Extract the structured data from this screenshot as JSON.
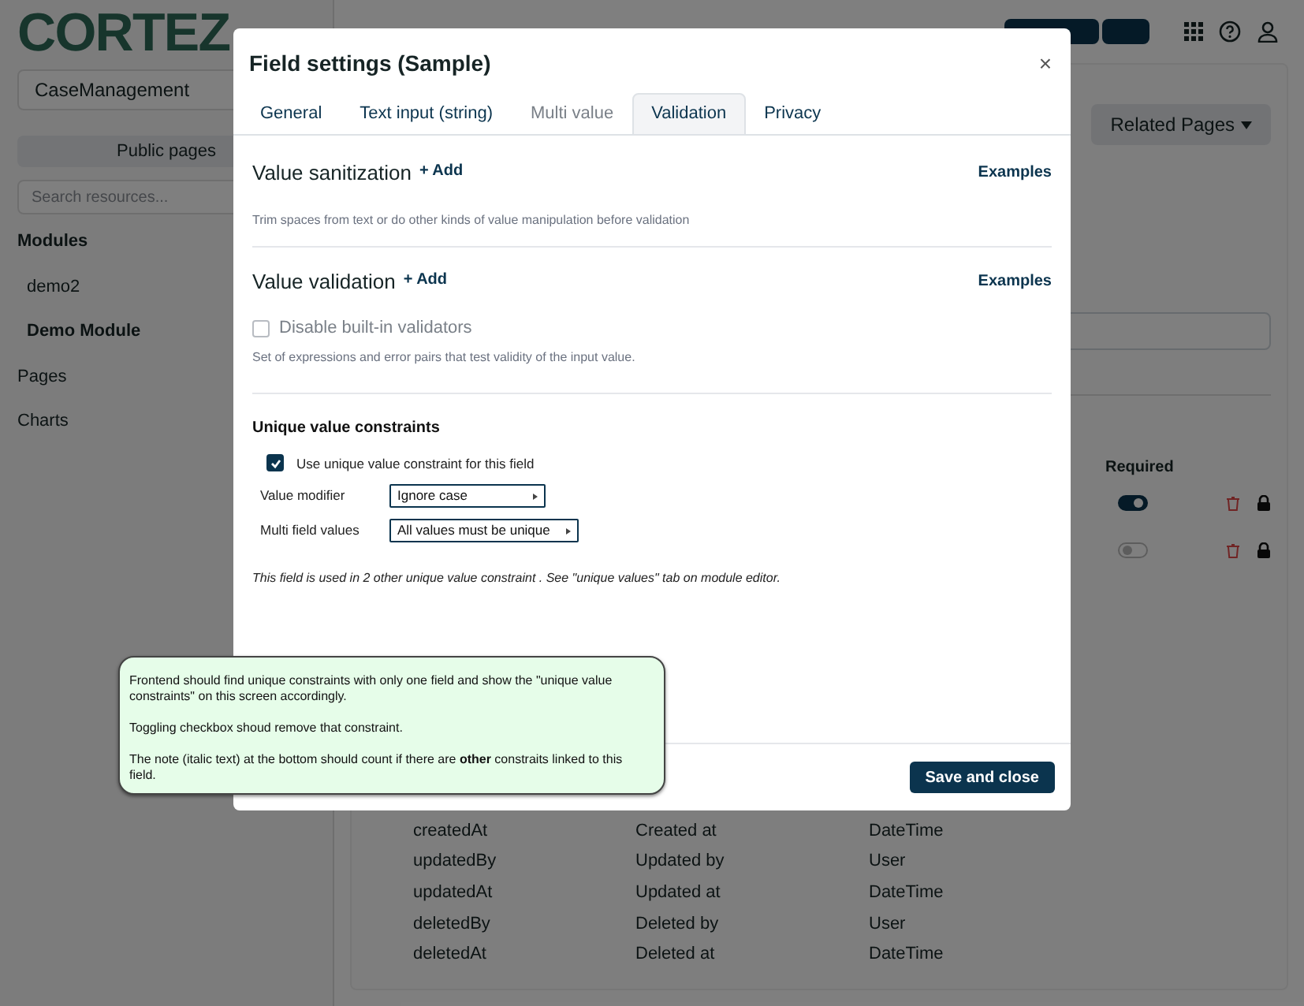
{
  "sidebar": {
    "logo": "CORTEZ",
    "namespace": "CaseManagement",
    "public_pages": "Public pages",
    "search": {
      "placeholder": "Search resources..."
    },
    "items": [
      {
        "label": "Modules",
        "expanded": true,
        "children": [
          {
            "label": "demo2",
            "selected": false
          },
          {
            "label": "Demo Module",
            "selected": true
          }
        ]
      },
      {
        "label": "Pages",
        "expanded": false
      },
      {
        "label": "Charts",
        "expanded": false
      }
    ]
  },
  "main": {
    "related_pages": "Related Pages",
    "required_header": "Required",
    "required_rows": [
      {
        "required": true
      },
      {
        "required": false
      }
    ],
    "fields": [
      {
        "name": "createdAt",
        "label": "Created at",
        "type": "DateTime"
      },
      {
        "name": "updatedBy",
        "label": "Updated by",
        "type": "User"
      },
      {
        "name": "updatedAt",
        "label": "Updated at",
        "type": "DateTime"
      },
      {
        "name": "deletedBy",
        "label": "Deleted by",
        "type": "User"
      },
      {
        "name": "deletedAt",
        "label": "Deleted at",
        "type": "DateTime"
      }
    ]
  },
  "modal": {
    "title": "Field settings (Sample)",
    "close": "×",
    "tabs": [
      {
        "label": "General",
        "selected": false,
        "disabled": false
      },
      {
        "label": "Text input (string)",
        "selected": false,
        "disabled": false
      },
      {
        "label": "Multi value",
        "selected": false,
        "disabled": true
      },
      {
        "label": "Validation",
        "selected": true,
        "disabled": false
      },
      {
        "label": "Privacy",
        "selected": false,
        "disabled": false
      }
    ],
    "sanitization": {
      "title": "Value sanitization",
      "add": "+ Add",
      "examples": "Examples",
      "description": "Trim spaces from text or do other kinds of value manipulation before validation"
    },
    "validation": {
      "title": "Value validation",
      "add": "+ Add",
      "examples": "Examples",
      "checkbox": {
        "label": "Disable built-in validators",
        "checked": false
      },
      "description": "Set of expressions and error pairs that test validity of the input value."
    },
    "unique": {
      "title": "Unique value constraints",
      "checkbox": {
        "label": "Use unique value constraint for this field",
        "checked": true
      },
      "selects": [
        {
          "label": "Value modifier",
          "value": "Ignore case"
        },
        {
          "label": "Multi field values",
          "value": "All values must be unique"
        }
      ],
      "note": "This field is used in 2 other unique value constraint . See \"unique values\" tab on module editor."
    },
    "save": "Save and close"
  },
  "sticky_note": {
    "paragraphs": [
      "Frontend should find unique constraints with only one field and show the \"unique value constraints\" on this screen accordingly.",
      "Toggling checkbox shoud remove that constraint.",
      "The note (italic text) at the bottom should count if there are **other** constraits linked to this field."
    ]
  }
}
